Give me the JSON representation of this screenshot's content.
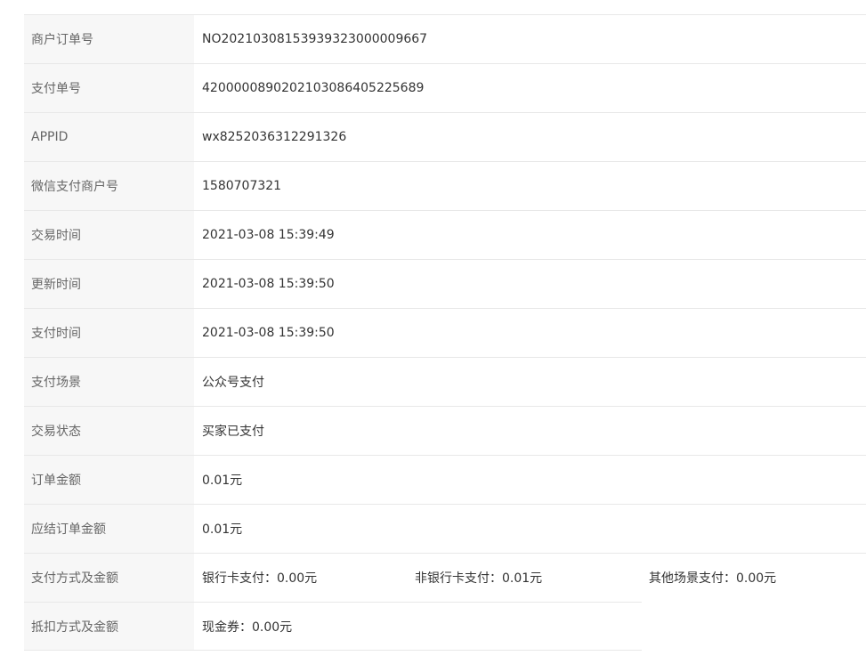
{
  "rows": [
    {
      "label": "商户订单号",
      "value": "NO20210308153939323000009667"
    },
    {
      "label": "支付单号",
      "value": "4200000890202103086405225689"
    },
    {
      "label": "APPID",
      "value": "wx8252036312291326"
    },
    {
      "label": "微信支付商户号",
      "value": "1580707321"
    },
    {
      "label": "交易时间",
      "value": "2021-03-08 15:39:49"
    },
    {
      "label": "更新时间",
      "value": "2021-03-08 15:39:50"
    },
    {
      "label": "支付时间",
      "value": "2021-03-08 15:39:50"
    },
    {
      "label": "支付场景",
      "value": "公众号支付"
    },
    {
      "label": "交易状态",
      "value": "买家已支付"
    },
    {
      "label": "订单金额",
      "value": "0.01元"
    },
    {
      "label": "应结订单金额",
      "value": "0.01元"
    }
  ],
  "payment_methods": {
    "label": "支付方式及金额",
    "bank_card": "银行卡支付：0.00元",
    "non_bank_card": "非银行卡支付：0.01元",
    "other": "其他场景支付：0.00元"
  },
  "deduction": {
    "label": "抵扣方式及金额",
    "cash_coupon": "现金券：0.00元"
  }
}
